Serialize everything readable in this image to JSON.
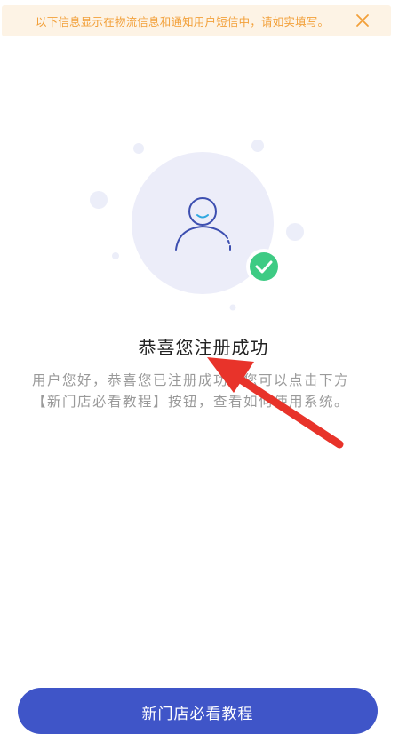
{
  "notice": {
    "text": "以下信息显示在物流信息和通知用户短信中，请如实填写。",
    "close_icon": "close-icon",
    "bg_color": "#fdf3e5",
    "text_color": "#f2a03a"
  },
  "illustration": {
    "avatar_icon": "user-avatar-icon",
    "check_icon": "check-circle-icon",
    "circle_color": "#ecedf9",
    "check_color": "#3ecb84"
  },
  "title": "恭喜您注册成功",
  "description": "用户您好，恭喜您已注册成功，您可以点击下方【新门店必看教程】按钮，查看如何使用系统。",
  "annotation": {
    "arrow_icon": "red-arrow-annotation",
    "color": "#e8332a"
  },
  "button": {
    "label": "新门店必看教程",
    "color": "#3f55c8"
  }
}
